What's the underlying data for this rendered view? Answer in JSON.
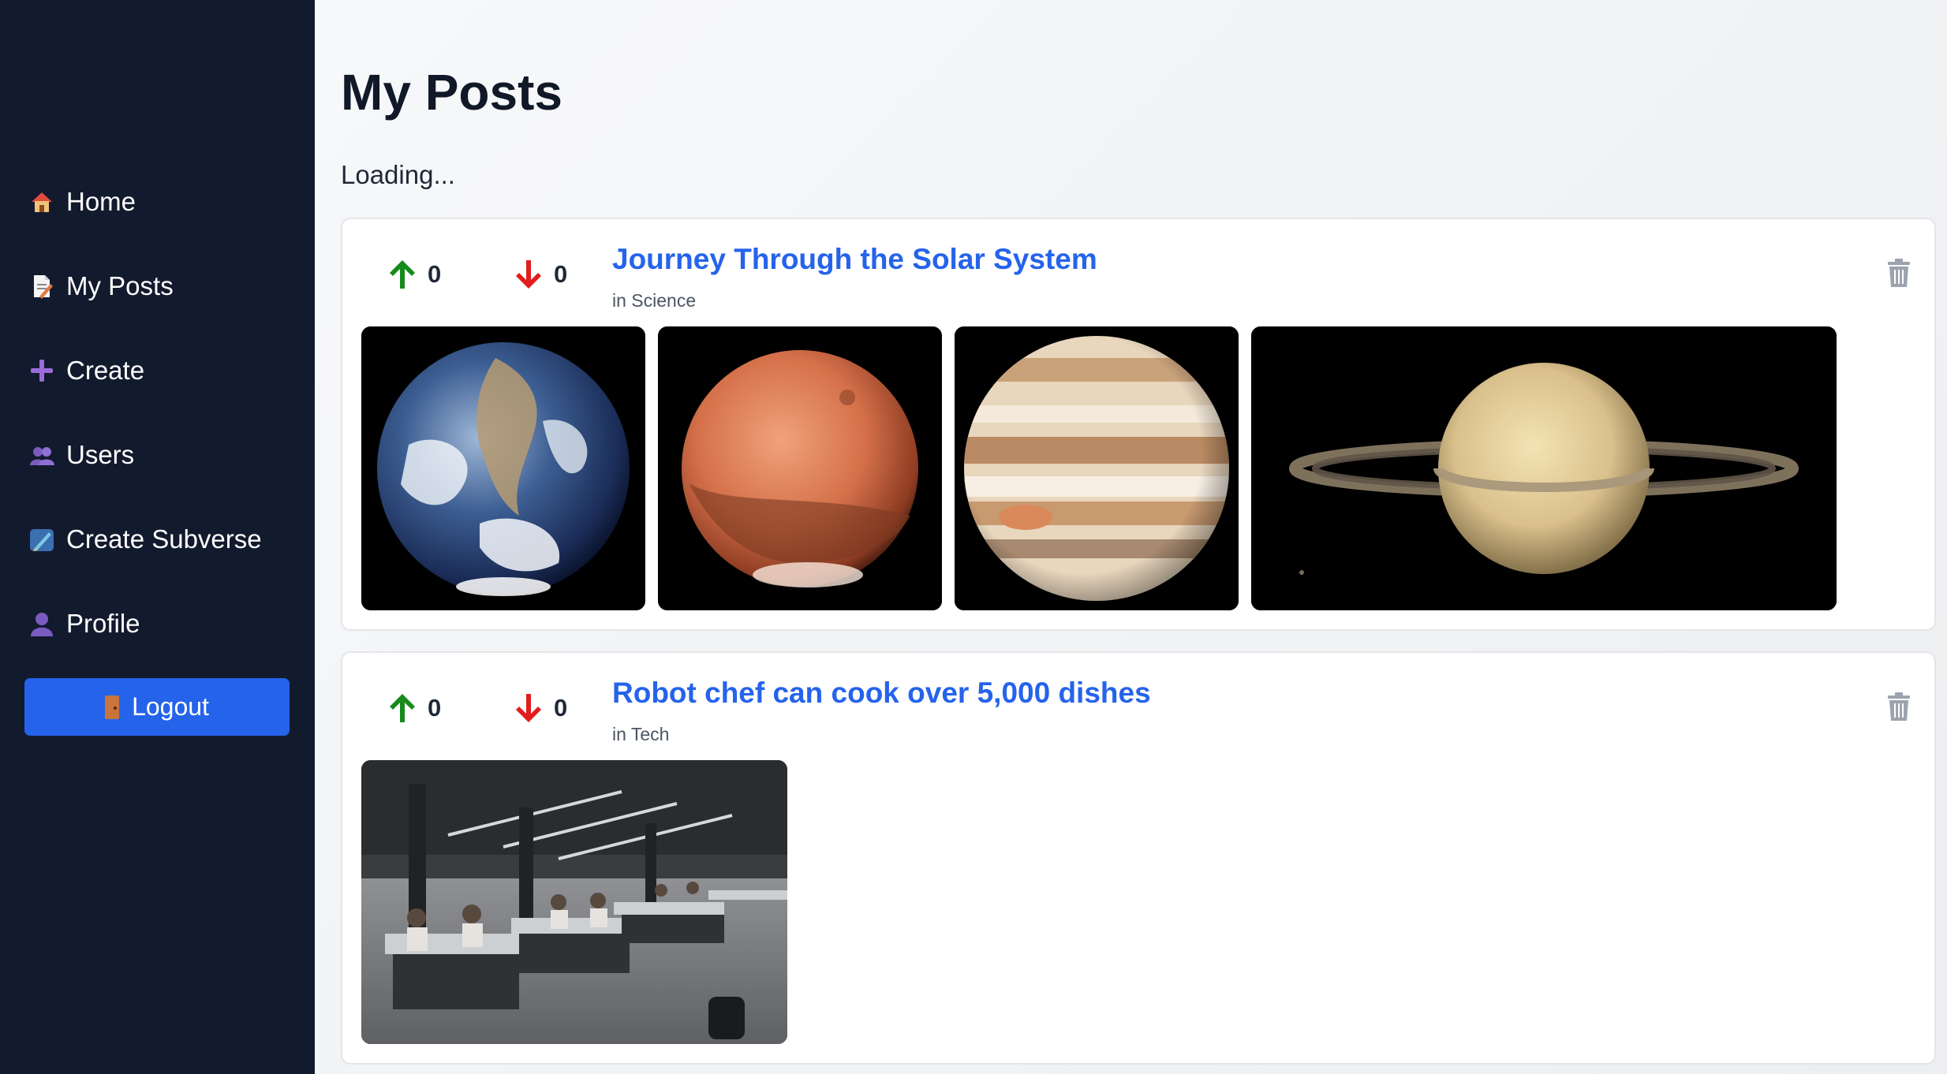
{
  "sidebar": {
    "items": [
      {
        "label": "Home",
        "icon": "house-icon"
      },
      {
        "label": "My Posts",
        "icon": "page-icon"
      },
      {
        "label": "Create",
        "icon": "plus-icon"
      },
      {
        "label": "Users",
        "icon": "users-icon"
      },
      {
        "label": "Create Subverse",
        "icon": "pen-icon"
      },
      {
        "label": "Profile",
        "icon": "user-icon"
      }
    ],
    "logout_label": "Logout"
  },
  "main": {
    "title": "My Posts",
    "status": "Loading..."
  },
  "posts": [
    {
      "title": "Journey Through the Solar System",
      "subverse": "in Science",
      "upvotes": "0",
      "downvotes": "0",
      "images": [
        "earth",
        "mars",
        "jupiter",
        "saturn"
      ]
    },
    {
      "title": "Robot chef can cook over 5,000 dishes",
      "subverse": "in Tech",
      "upvotes": "0",
      "downvotes": "0",
      "images": [
        "office"
      ]
    }
  ],
  "colors": {
    "sidebar_bg": "#121a2e",
    "accent": "#2563eb",
    "upvote": "#178a1c",
    "downvote": "#e11d1d"
  }
}
